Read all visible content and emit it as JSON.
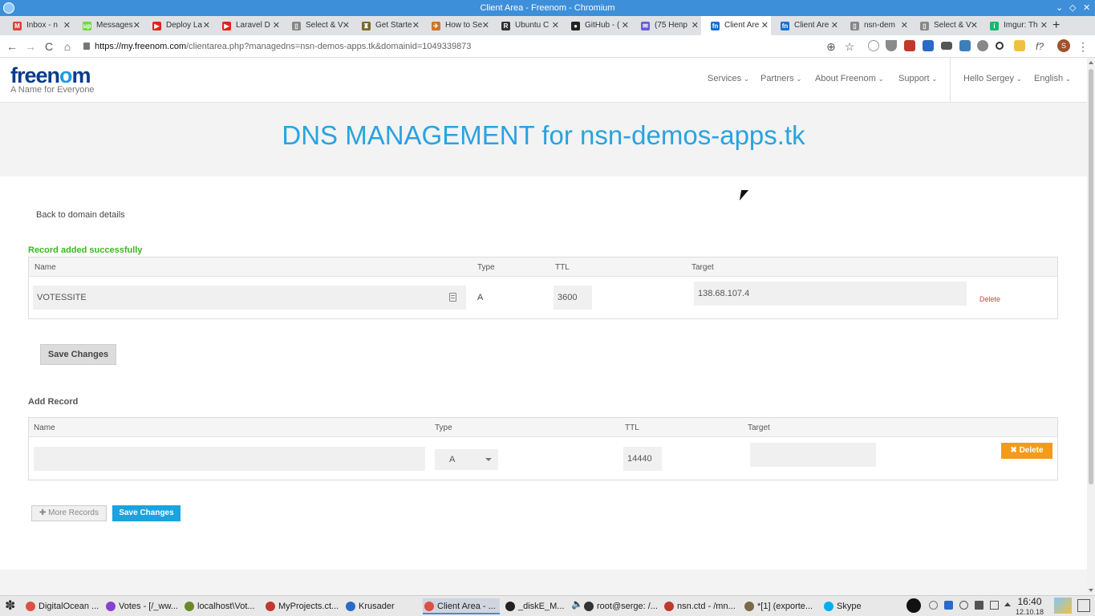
{
  "window": {
    "title": "Client Area - Freenom - Chromium",
    "controls": [
      "⌄",
      "◇",
      "✕"
    ]
  },
  "browser": {
    "tabs": [
      {
        "label": "Inbox - n",
        "icon": "gmail-icon",
        "color": "#db4437",
        "glyph": "M",
        "active": false
      },
      {
        "label": "Messages",
        "icon": "upwork-icon",
        "color": "#6fda44",
        "glyph": "up",
        "active": false
      },
      {
        "label": "Deploy La",
        "icon": "youtube-icon",
        "color": "#e62117",
        "glyph": "▶",
        "active": false
      },
      {
        "label": "Laravel D",
        "icon": "youtube-icon",
        "color": "#e62117",
        "glyph": "▶",
        "active": false
      },
      {
        "label": "Select & V",
        "icon": "page-icon",
        "color": "#888888",
        "glyph": "▯",
        "active": false
      },
      {
        "label": "Get Starte",
        "icon": "bottle-icon",
        "color": "#7a6a2a",
        "glyph": "♜",
        "active": false
      },
      {
        "label": "How to Se",
        "icon": "bird-icon",
        "color": "#c8762a",
        "glyph": "✈",
        "active": false
      },
      {
        "label": "Ubuntu C",
        "icon": "r-icon",
        "color": "#333333",
        "glyph": "R",
        "active": false
      },
      {
        "label": "GitHub - (",
        "icon": "github-icon",
        "color": "#222222",
        "glyph": "●",
        "active": false
      },
      {
        "label": "(75 Непр",
        "icon": "mail-icon",
        "color": "#6b5bd6",
        "glyph": "✉",
        "active": false
      },
      {
        "label": "Client Are",
        "icon": "freenom-icon",
        "color": "#1b6fc8",
        "glyph": "fn",
        "active": true
      },
      {
        "label": "Client Are",
        "icon": "freenom-icon",
        "color": "#1b6fc8",
        "glyph": "fn",
        "active": false
      },
      {
        "label": "nsn-dem",
        "icon": "page-icon",
        "color": "#888888",
        "glyph": "▯",
        "active": false
      },
      {
        "label": "Select & V",
        "icon": "page-icon",
        "color": "#888888",
        "glyph": "▯",
        "active": false
      },
      {
        "label": "Imgur: Th",
        "icon": "imgur-icon",
        "color": "#1bb76e",
        "glyph": "i",
        "active": false
      }
    ],
    "new_tab": "+",
    "tab_close": "✕",
    "url_host": "https://my.freenom.com",
    "url_rest": "/clientarea.php?managedns=nsn-demos-apps.tk&domainid=1049339873",
    "nav": {
      "back": "←",
      "forward": "→",
      "reload": "C",
      "home": "⌂"
    },
    "right_icons": {
      "zoom": "⊕",
      "star": "☆",
      "f": "f?",
      "menu": "⋮",
      "avatar": "S"
    }
  },
  "site": {
    "logo": {
      "part1": "free",
      "part2": "n",
      "part3": "o",
      "part4": "m"
    },
    "tagline": "A Name for Everyone",
    "nav": [
      "Services",
      "Partners",
      "About Freenom",
      "Support"
    ],
    "user_menu": "Hello Sergey",
    "language": "English",
    "chevron": "⌄"
  },
  "page": {
    "title": "DNS MANAGEMENT for nsn-demos-apps.tk",
    "back_link": "Back to domain details",
    "success_message": "Record added successfully",
    "records_table": {
      "headers": [
        "Name",
        "Type",
        "TTL",
        "Target"
      ],
      "row": {
        "name": "VOTESSITE",
        "type": "A",
        "ttl": "3600",
        "target": "138.68.107.4",
        "delete": "Delete"
      }
    },
    "save_changes": "Save Changes",
    "add_record": {
      "title": "Add Record",
      "headers": [
        "Name",
        "Type",
        "TTL",
        "Target"
      ],
      "row": {
        "name": "",
        "type": "A",
        "ttl": "14440",
        "target": "",
        "delete": "✖ Delete"
      }
    },
    "more_records": "✚ More Records",
    "save_changes_2": "Save Changes"
  },
  "taskbar": {
    "start": "✽",
    "tasks": [
      {
        "label": "DigitalOcean ...",
        "icon": "chrome-icon",
        "color": "#dd5044",
        "active": false
      },
      {
        "label": "Votes - [/_ww...",
        "icon": "phpstorm-icon",
        "color": "#8b3fcf",
        "active": false
      },
      {
        "label": "localhost\\Vot...",
        "icon": "database-icon",
        "color": "#6a8a2a",
        "active": false
      },
      {
        "label": "MyProjects.ct...",
        "icon": "cherry-icon",
        "color": "#c0392b",
        "active": false
      },
      {
        "label": "Krusader",
        "icon": "krusader-icon",
        "color": "#2a6ac8",
        "active": false
      },
      {
        "label": "Client Area - ...",
        "icon": "chrome-icon",
        "color": "#dd5044",
        "active": true
      },
      {
        "label": "_diskE_M...",
        "icon": "media-icon",
        "color": "#222222",
        "active": false
      },
      {
        "label": "root@serge: /...",
        "icon": "terminal-icon",
        "color": "#333333",
        "active": false
      },
      {
        "label": "nsn.ctd - /mn...",
        "icon": "cherry-icon",
        "color": "#c0392b",
        "active": false
      },
      {
        "label": "*[1] (exporte...",
        "icon": "gimp-icon",
        "color": "#7a6a4a",
        "active": false
      },
      {
        "label": "Skype",
        "icon": "skype-icon",
        "color": "#00aff0",
        "active": false
      }
    ],
    "volume": "🔈",
    "clock_time": "16:40",
    "clock_date": "12.10.18"
  }
}
